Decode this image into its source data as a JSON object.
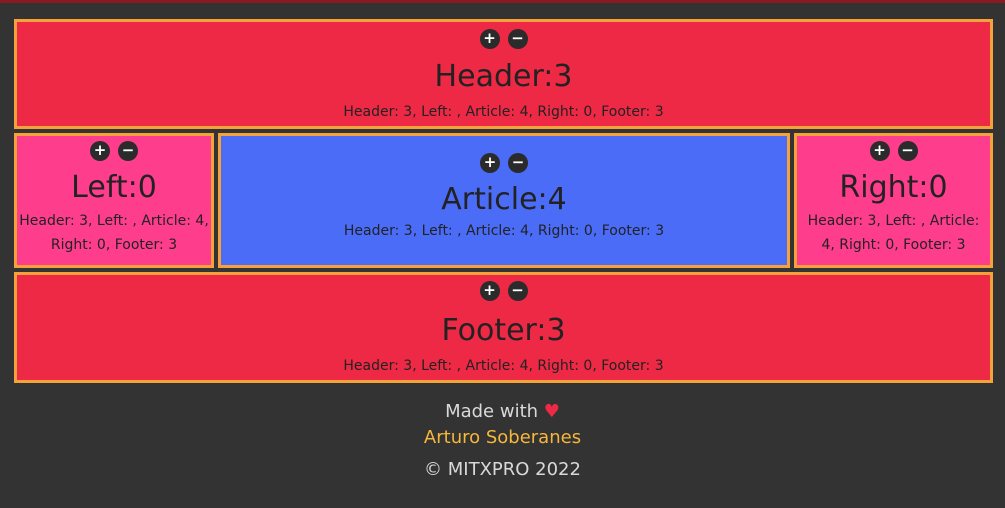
{
  "sections": {
    "header": {
      "title": "Header:3",
      "summary": "Header: 3, Left: , Article: 4, Right: 0, Footer: 3",
      "plus": "+",
      "minus": "−"
    },
    "left": {
      "title": "Left:0",
      "summary": "Header: 3, Left: , Article: 4, Right: 0, Footer: 3",
      "plus": "+",
      "minus": "−"
    },
    "article": {
      "title": "Article:4",
      "summary": "Header: 3, Left: , Article: 4, Right: 0, Footer: 3",
      "plus": "+",
      "minus": "−"
    },
    "right": {
      "title": "Right:0",
      "summary": "Header: 3, Left: , Article: 4, Right: 0, Footer: 3",
      "plus": "+",
      "minus": "−"
    },
    "footer": {
      "title": "Footer:3",
      "summary": "Header: 3, Left: , Article: 4, Right: 0, Footer: 3",
      "plus": "+",
      "minus": "−"
    }
  },
  "credits": {
    "made_with": "Made with",
    "heart": "♥",
    "author": "Arturo Soberanes",
    "copyright": "© MITXPRO 2022"
  },
  "colors": {
    "background": "#333333",
    "red_section": "#ee2945",
    "pink_section": "#fe3e8d",
    "blue_section": "#4a6cf7",
    "border": "#f6a23a",
    "author_link": "#f6b73c"
  }
}
